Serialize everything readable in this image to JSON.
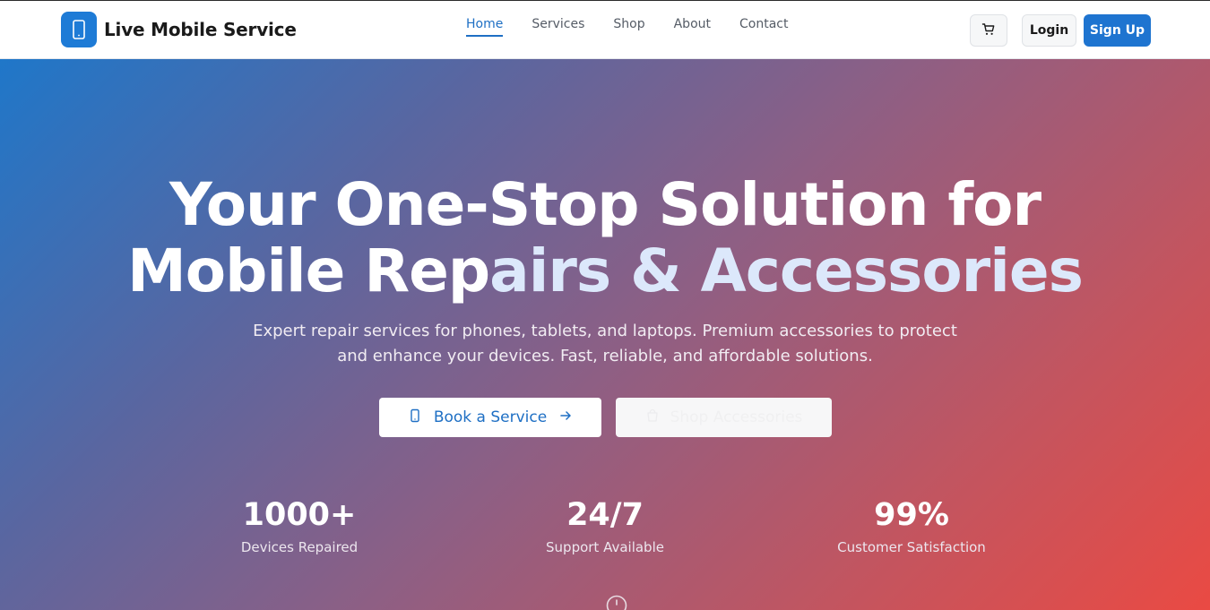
{
  "brand": {
    "name": "Live Mobile Service",
    "logo_icon": "smartphone-icon"
  },
  "nav": {
    "links": [
      {
        "label": "Home",
        "active": true
      },
      {
        "label": "Services",
        "active": false
      },
      {
        "label": "Shop",
        "active": false
      },
      {
        "label": "About",
        "active": false
      },
      {
        "label": "Contact",
        "active": false
      }
    ],
    "cart_icon": "shopping-cart-icon",
    "login_label": "Login",
    "signup_label": "Sign Up"
  },
  "hero": {
    "title_line1": "Your One-Stop Solution for",
    "title_line2_plain": "Mobile Rep",
    "title_line2_accent": "airs & Accessories",
    "subtitle_line1": "Expert repair services for phones, tablets, and laptops. Premium accessories to protect",
    "subtitle_line2": "and enhance your devices. Fast, reliable, and affordable solutions.",
    "primary_cta": {
      "label": "Book a Service",
      "icon": "smartphone-icon",
      "trailing_icon": "arrow-right-icon"
    },
    "secondary_cta": {
      "label": "Shop Accessories",
      "icon": "shopping-bag-icon"
    },
    "stats": [
      {
        "value": "1000+",
        "label": "Devices Repaired"
      },
      {
        "value": "24/7",
        "label": "Support Available"
      },
      {
        "value": "99%",
        "label": "Customer Satisfaction"
      }
    ],
    "scroll_icon": "scroll-down-icon"
  },
  "colors": {
    "brand_blue": "#1e74d0",
    "gradient_start": "#1f77c9",
    "gradient_end": "#ea4a43",
    "title_accent": "#dce8fb"
  }
}
